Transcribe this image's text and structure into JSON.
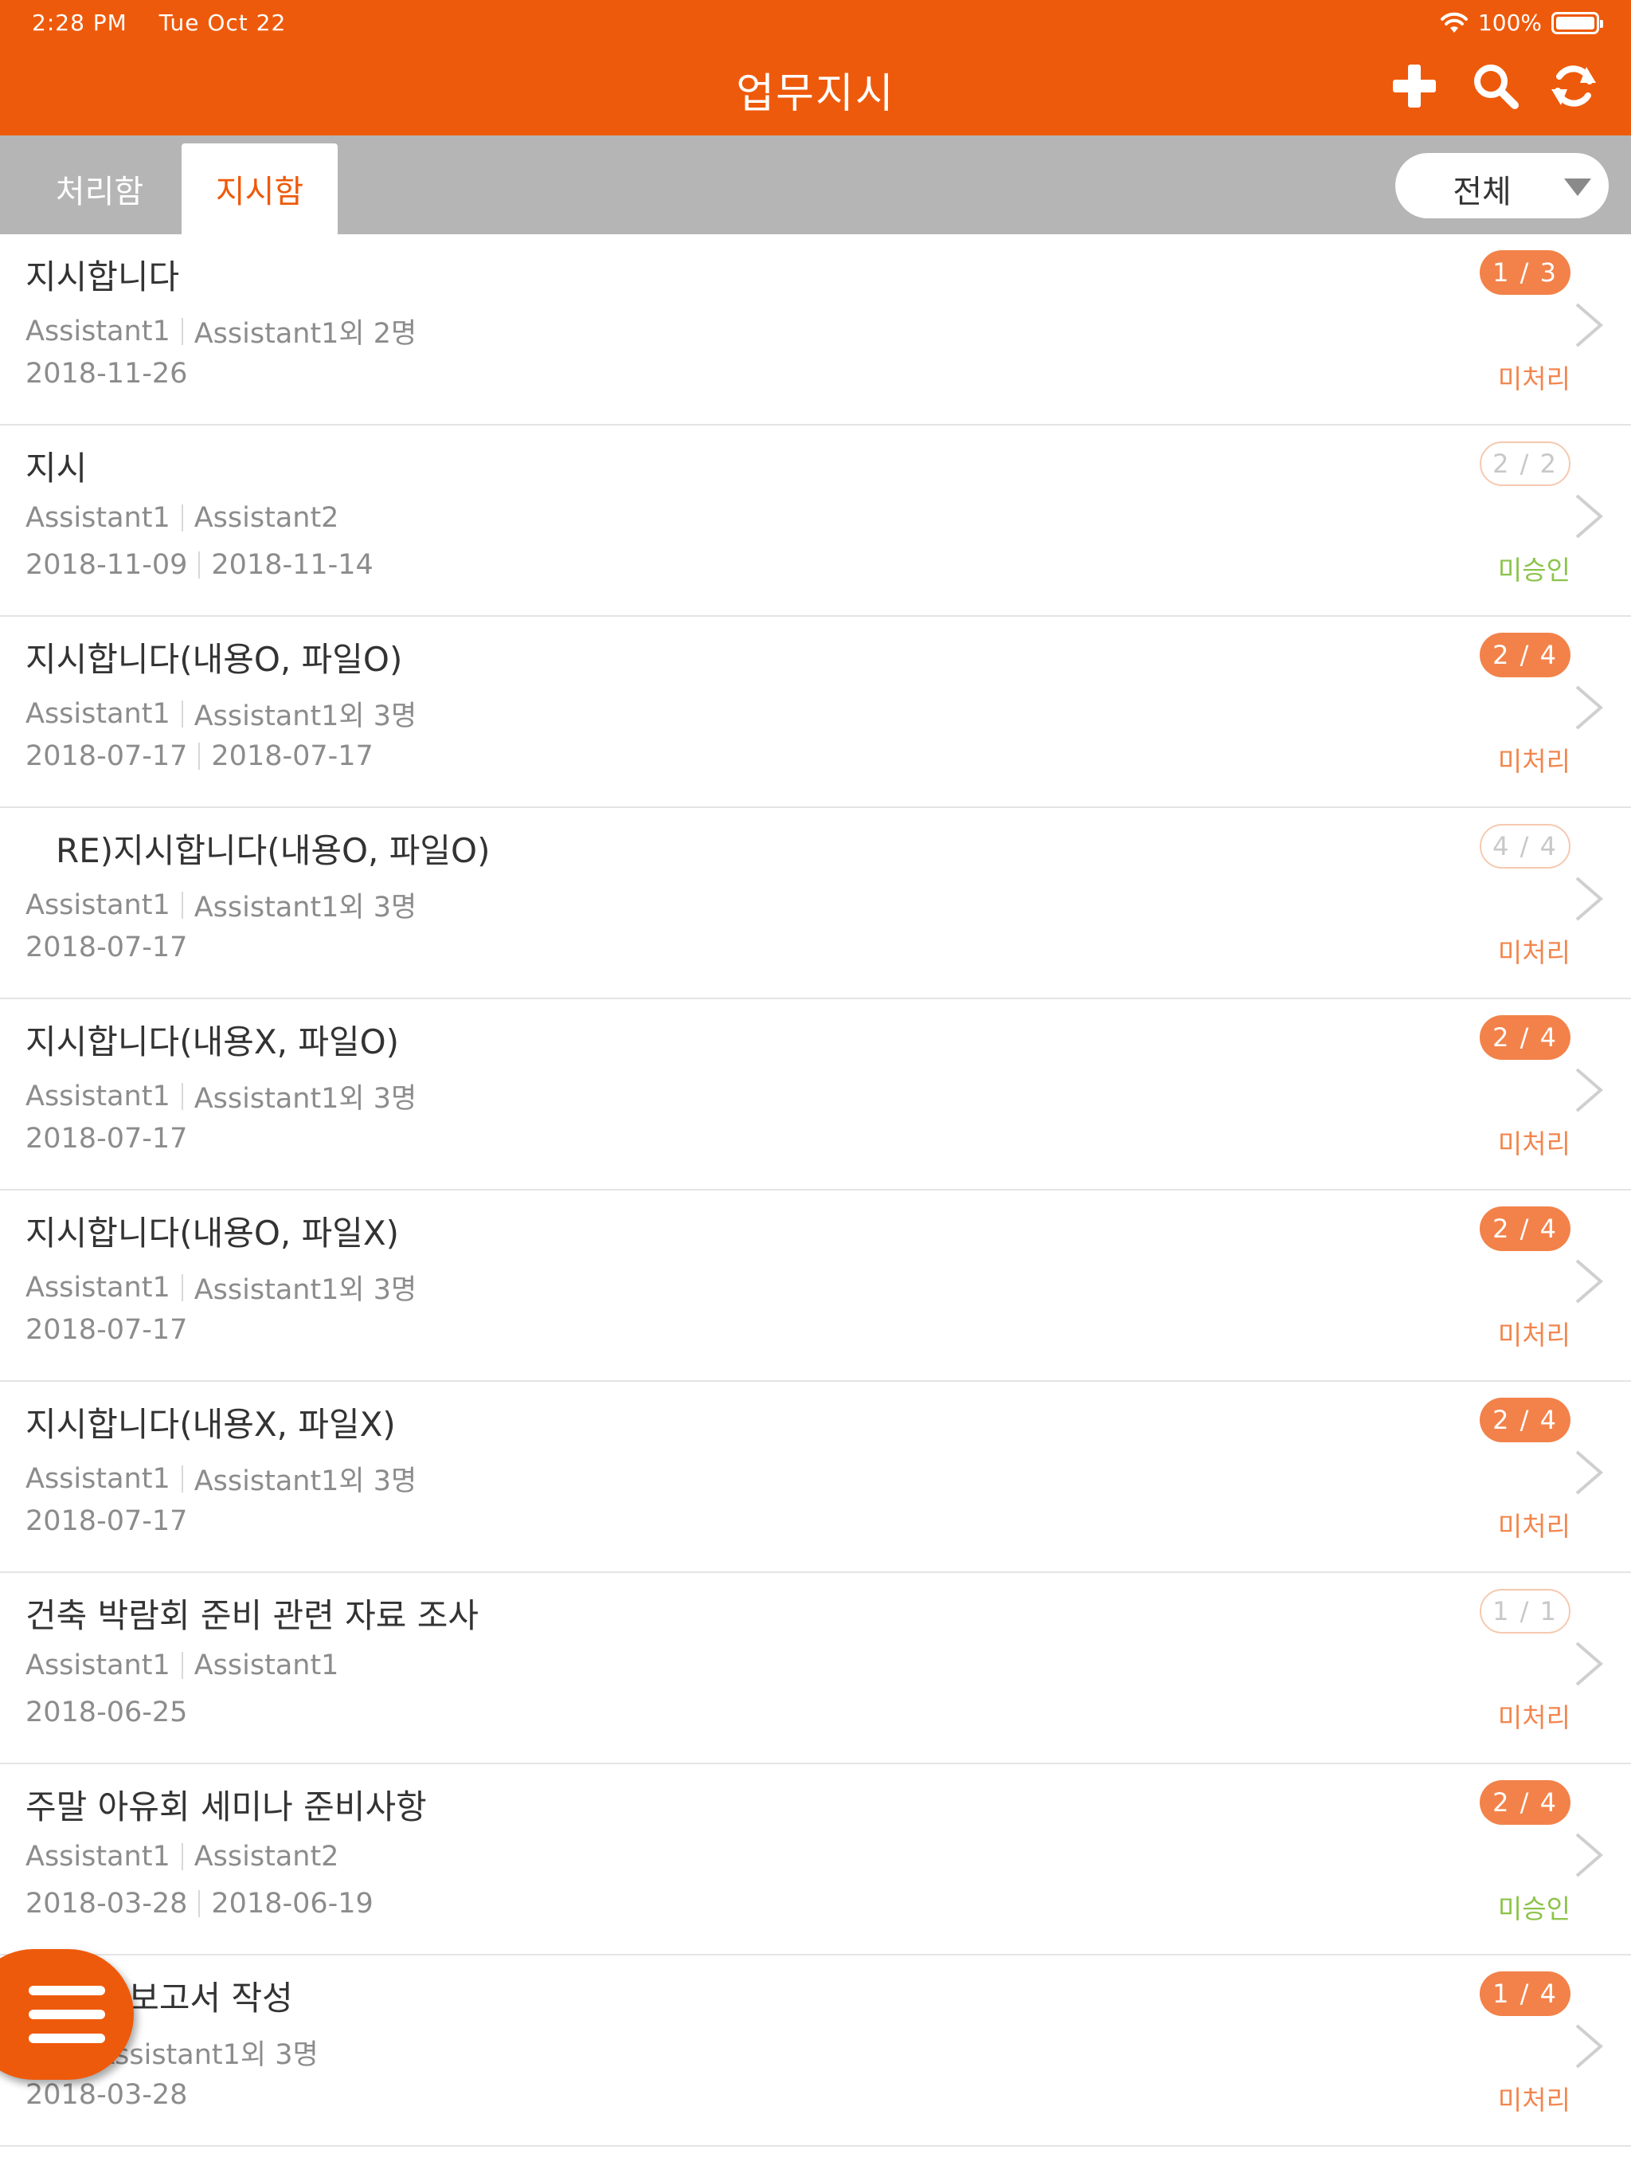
{
  "status_bar": {
    "time": "2:28 PM",
    "date": "Tue Oct 22",
    "battery": "100%"
  },
  "header": {
    "title": "업무지시"
  },
  "tabs": {
    "inactive": "처리함",
    "active": "지시함"
  },
  "filter": {
    "selected": "전체"
  },
  "colors": {
    "brand": "#ee5a0b",
    "badge": "#f2824a",
    "pending": "#f2864e",
    "unapproved": "#8cc34a"
  },
  "items": [
    {
      "title": "지시합니다",
      "from": "Assistant1",
      "to": "Assistant1외 2명",
      "date": "2018-11-26",
      "due": "",
      "badge": "1 / 3",
      "badge_style": "filled",
      "status": "미처리",
      "status_type": "pending"
    },
    {
      "title": "지시",
      "from": "Assistant1",
      "to": "Assistant2",
      "date": "2018-11-09",
      "due": "2018-11-14",
      "badge": "2 / 2",
      "badge_style": "outline",
      "status": "미승인",
      "status_type": "unapproved"
    },
    {
      "title": "지시합니다(내용O, 파일O)",
      "from": "Assistant1",
      "to": "Assistant1외 3명",
      "date": "2018-07-17",
      "due": "2018-07-17",
      "badge": "2 / 4",
      "badge_style": "filled",
      "status": "미처리",
      "status_type": "pending"
    },
    {
      "title": "RE)지시합니다(내용O, 파일O)",
      "indent": true,
      "from": "Assistant1",
      "to": "Assistant1외 3명",
      "date": "2018-07-17",
      "due": "",
      "badge": "4 / 4",
      "badge_style": "outline",
      "status": "미처리",
      "status_type": "pending"
    },
    {
      "title": "지시합니다(내용X, 파일O)",
      "from": "Assistant1",
      "to": "Assistant1외 3명",
      "date": "2018-07-17",
      "due": "",
      "badge": "2 / 4",
      "badge_style": "filled",
      "status": "미처리",
      "status_type": "pending"
    },
    {
      "title": "지시합니다(내용O, 파일X)",
      "from": "Assistant1",
      "to": "Assistant1외 3명",
      "date": "2018-07-17",
      "due": "",
      "badge": "2 / 4",
      "badge_style": "filled",
      "status": "미처리",
      "status_type": "pending"
    },
    {
      "title": "지시합니다(내용X, 파일X)",
      "from": "Assistant1",
      "to": "Assistant1외 3명",
      "date": "2018-07-17",
      "due": "",
      "badge": "2 / 4",
      "badge_style": "filled",
      "status": "미처리",
      "status_type": "pending"
    },
    {
      "title": "건축 박람회 준비 관련 자료 조사",
      "from": "Assistant1",
      "to": "Assistant1",
      "date": "2018-06-25",
      "due": "",
      "badge": "1 / 1",
      "badge_style": "outline",
      "status": "미처리",
      "status_type": "pending"
    },
    {
      "title": "주말 아유회 세미나 준비사항",
      "from": "Assistant1",
      "to": "Assistant2",
      "date": "2018-03-28",
      "due": "2018-06-19",
      "badge": "2 / 4",
      "badge_style": "filled",
      "status": "미승인",
      "status_type": "unapproved"
    },
    {
      "title": "증 결과보고서 작성",
      "from": "nt1",
      "to": "Assistant1외 3명",
      "date": "2018-03-28",
      "due": "",
      "badge": "1 / 4",
      "badge_style": "filled",
      "status": "미처리",
      "status_type": "pending"
    }
  ]
}
